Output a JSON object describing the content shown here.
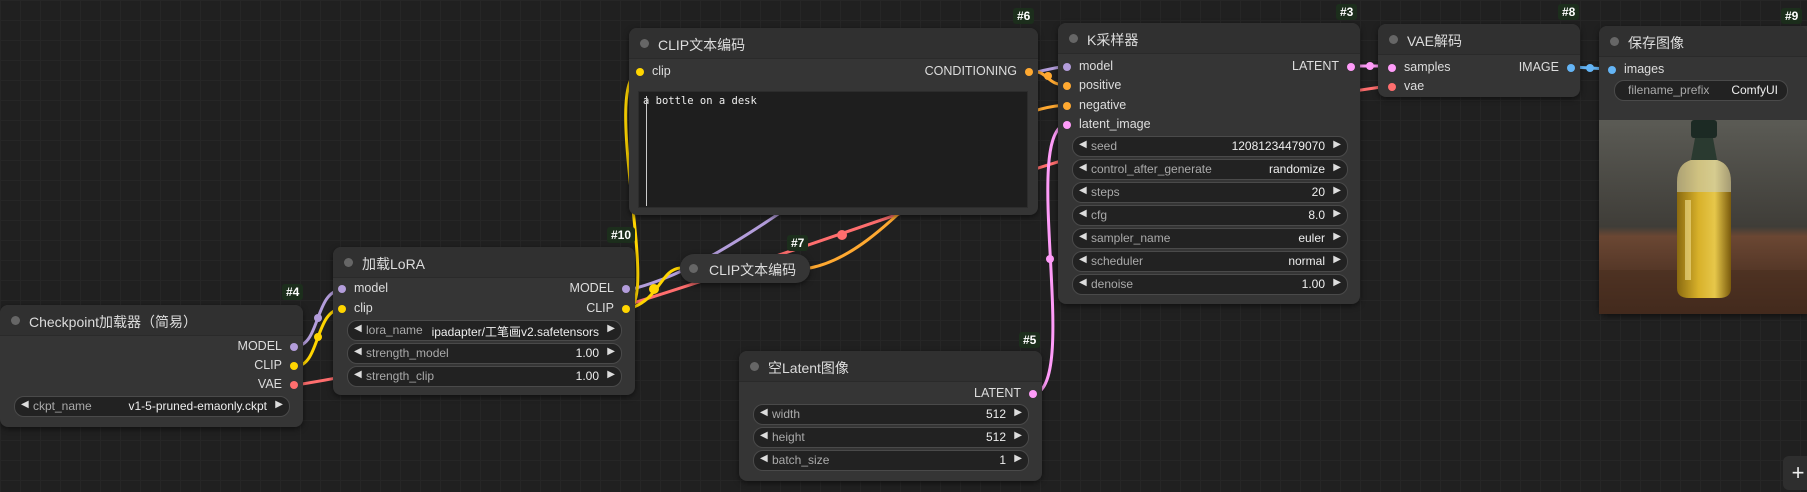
{
  "colors": {
    "model": "#b39ddb",
    "clip": "#ffd500",
    "vae": "#ff6e6e",
    "conditioning": "#ffa931",
    "latent": "#ff9cf9",
    "image": "#64b5f6"
  },
  "nodes": {
    "checkpoint": {
      "badge": "#4",
      "title": "Checkpoint加载器（简易）",
      "outputs": [
        "MODEL",
        "CLIP",
        "VAE"
      ],
      "widgets": [
        {
          "label": "ckpt_name",
          "value": "v1-5-pruned-emaonly.ckpt"
        }
      ]
    },
    "lora": {
      "badge": "#10",
      "title": "加载LoRA",
      "inputs": [
        "model",
        "clip"
      ],
      "outputs": [
        "MODEL",
        "CLIP"
      ],
      "widgets": [
        {
          "label": "lora_name",
          "value": "ipadapter/工笔画v2.safetensors"
        },
        {
          "label": "strength_model",
          "value": "1.00"
        },
        {
          "label": "strength_clip",
          "value": "1.00"
        }
      ]
    },
    "clip_pos": {
      "badge": "#6",
      "title": "CLIP文本编码",
      "inputs": [
        "clip"
      ],
      "outputs": [
        "CONDITIONING"
      ],
      "text": "a bottle on a desk"
    },
    "clip_neg": {
      "badge": "#7",
      "title": "CLIP文本编码"
    },
    "empty_latent": {
      "badge": "#5",
      "title": "空Latent图像",
      "outputs": [
        "LATENT"
      ],
      "widgets": [
        {
          "label": "width",
          "value": "512"
        },
        {
          "label": "height",
          "value": "512"
        },
        {
          "label": "batch_size",
          "value": "1"
        }
      ]
    },
    "ksampler": {
      "badge": "#3",
      "title": "K采样器",
      "inputs": [
        "model",
        "positive",
        "negative",
        "latent_image"
      ],
      "outputs": [
        "LATENT"
      ],
      "widgets": [
        {
          "label": "seed",
          "value": "12081234479070"
        },
        {
          "label": "control_after_generate",
          "value": "randomize"
        },
        {
          "label": "steps",
          "value": "20"
        },
        {
          "label": "cfg",
          "value": "8.0"
        },
        {
          "label": "sampler_name",
          "value": "euler"
        },
        {
          "label": "scheduler",
          "value": "normal"
        },
        {
          "label": "denoise",
          "value": "1.00"
        }
      ]
    },
    "vae_decode": {
      "badge": "#8",
      "title": "VAE解码",
      "inputs": [
        "samples",
        "vae"
      ],
      "outputs": [
        "IMAGE"
      ]
    },
    "save_image": {
      "badge": "#9",
      "title": "保存图像",
      "inputs": [
        "images"
      ],
      "widgets": [
        {
          "label": "filename_prefix",
          "value": "ComfyUI"
        }
      ]
    }
  },
  "toolbar": {
    "add_label": "+"
  }
}
